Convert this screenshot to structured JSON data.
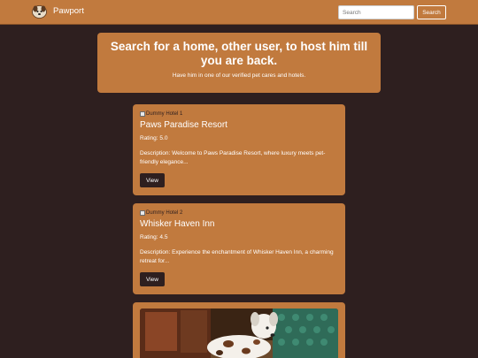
{
  "navbar": {
    "brand": "Pawport",
    "search_placeholder": "Search",
    "search_button": "Search"
  },
  "hero": {
    "title": "Search for a home, other user, to host him till you are back.",
    "subtitle": "Have him in one of our verified pet cares and hotels."
  },
  "cards": [
    {
      "image_alt": "Dummy Hotel 1",
      "name": "Paws Paradise Resort",
      "rating": "Rating: 5.0",
      "description": "Description: Welcome to Paws Paradise Resort, where luxury meets pet-friendly elegance...",
      "button": "View"
    },
    {
      "image_alt": "Dummy Hotel 2",
      "name": "Whisker Haven Inn",
      "rating": "Rating: 4.5",
      "description": "Description: Experience the enchantment of Whisker Haven Inn, a charming retreat for...",
      "button": "View"
    }
  ],
  "colors": {
    "background": "#2e1f1f",
    "accent": "#c17a3e"
  }
}
